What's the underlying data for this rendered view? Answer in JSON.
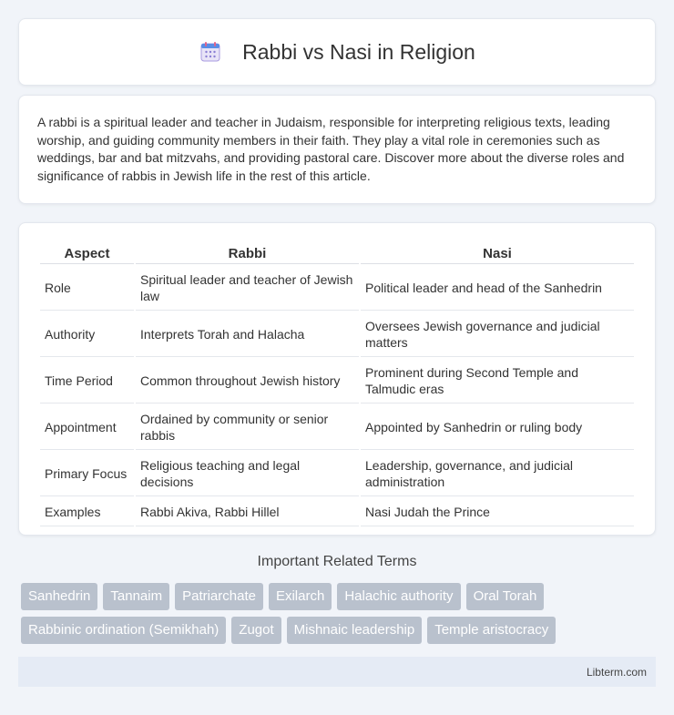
{
  "header": {
    "title": "Rabbi vs Nasi in Religion",
    "icon": "calendar-icon"
  },
  "intro": {
    "text": "A rabbi is a spiritual leader and teacher in Judaism, responsible for interpreting religious texts, leading worship, and guiding community members in their faith. They play a vital role in ceremonies such as weddings, bar and bat mitzvahs, and providing pastoral care. Discover more about the diverse roles and significance of rabbis in Jewish life in the rest of this article."
  },
  "table": {
    "headers": [
      "Aspect",
      "Rabbi",
      "Nasi"
    ],
    "rows": [
      [
        "Role",
        "Spiritual leader and teacher of Jewish law",
        "Political leader and head of the Sanhedrin"
      ],
      [
        "Authority",
        "Interprets Torah and Halacha",
        "Oversees Jewish governance and judicial matters"
      ],
      [
        "Time Period",
        "Common throughout Jewish history",
        "Prominent during Second Temple and Talmudic eras"
      ],
      [
        "Appointment",
        "Ordained by community or senior rabbis",
        "Appointed by Sanhedrin or ruling body"
      ],
      [
        "Primary Focus",
        "Religious teaching and legal decisions",
        "Leadership, governance, and judicial administration"
      ],
      [
        "Examples",
        "Rabbi Akiva, Rabbi Hillel",
        "Nasi Judah the Prince"
      ]
    ]
  },
  "related": {
    "title": "Important Related Terms",
    "tags": [
      "Sanhedrin",
      "Tannaim",
      "Patriarchate",
      "Exilarch",
      "Halachic authority",
      "Oral Torah",
      "Rabbinic ordination (Semikhah)",
      "Zugot",
      "Mishnaic leadership",
      "Temple aristocracy"
    ]
  },
  "footer": {
    "text": "Libterm.com"
  },
  "colors": {
    "background": "#f1f4f9",
    "tag": "#b9c1cd",
    "footer": "#e5ebf5"
  }
}
